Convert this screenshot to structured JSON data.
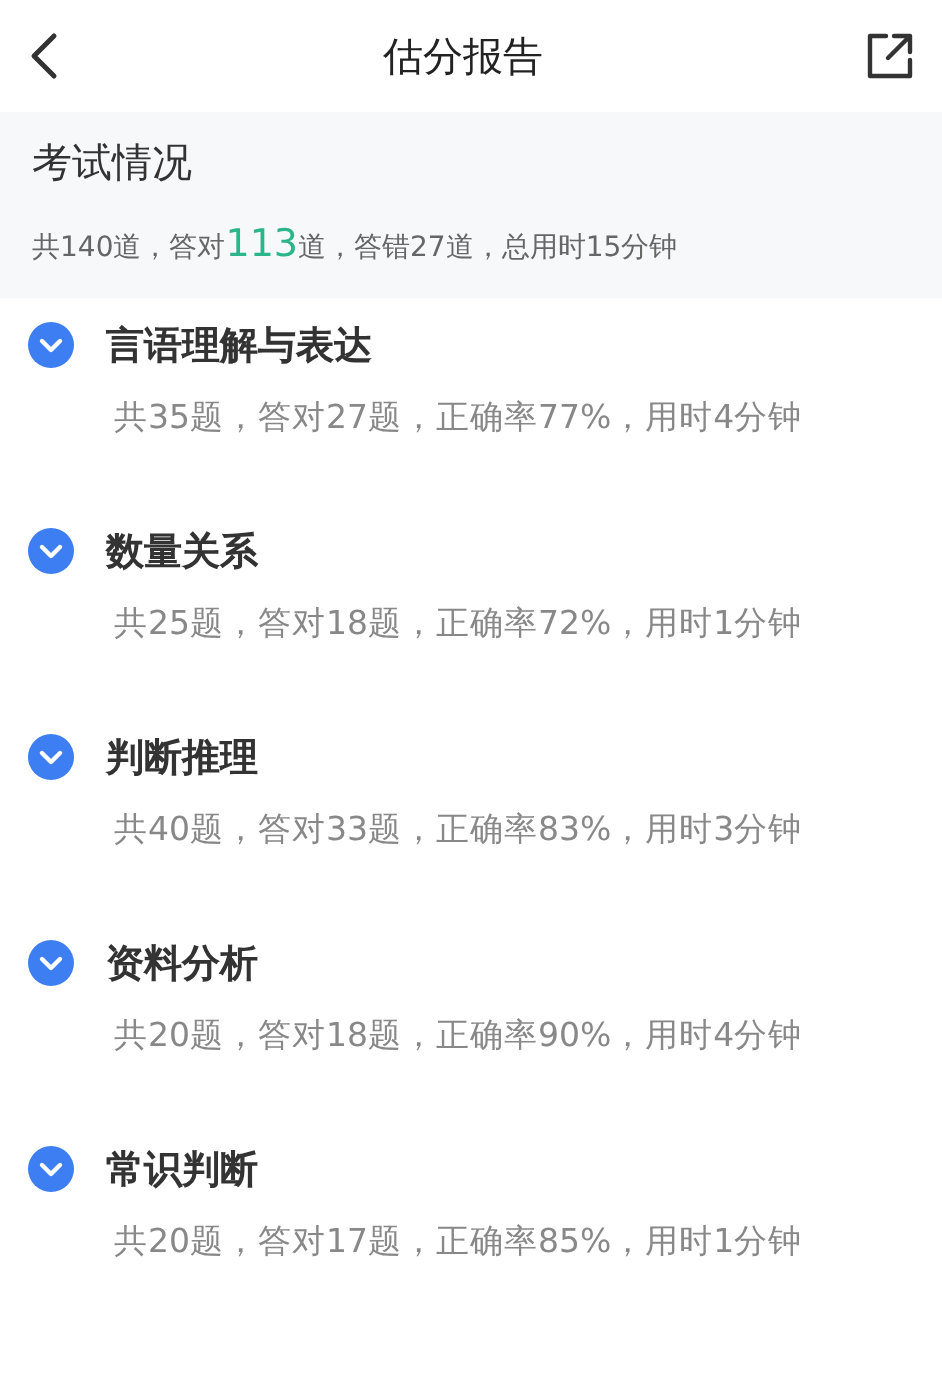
{
  "header": {
    "title": "估分报告"
  },
  "overview": {
    "title": "考试情况",
    "summary": {
      "before": "共140道，答对",
      "highlight": "113",
      "after": "道，答错27道，总用时15分钟"
    }
  },
  "sections": [
    {
      "title": "言语理解与表达",
      "detail": "共35题，答对27题，正确率77%，用时4分钟"
    },
    {
      "title": "数量关系",
      "detail": "共25题，答对18题，正确率72%，用时1分钟"
    },
    {
      "title": "判断推理",
      "detail": "共40题，答对33题，正确率83%，用时3分钟"
    },
    {
      "title": "资料分析",
      "detail": "共20题，答对18题，正确率90%，用时4分钟"
    },
    {
      "title": "常识判断",
      "detail": "共20题，答对17题，正确率85%，用时1分钟"
    }
  ]
}
